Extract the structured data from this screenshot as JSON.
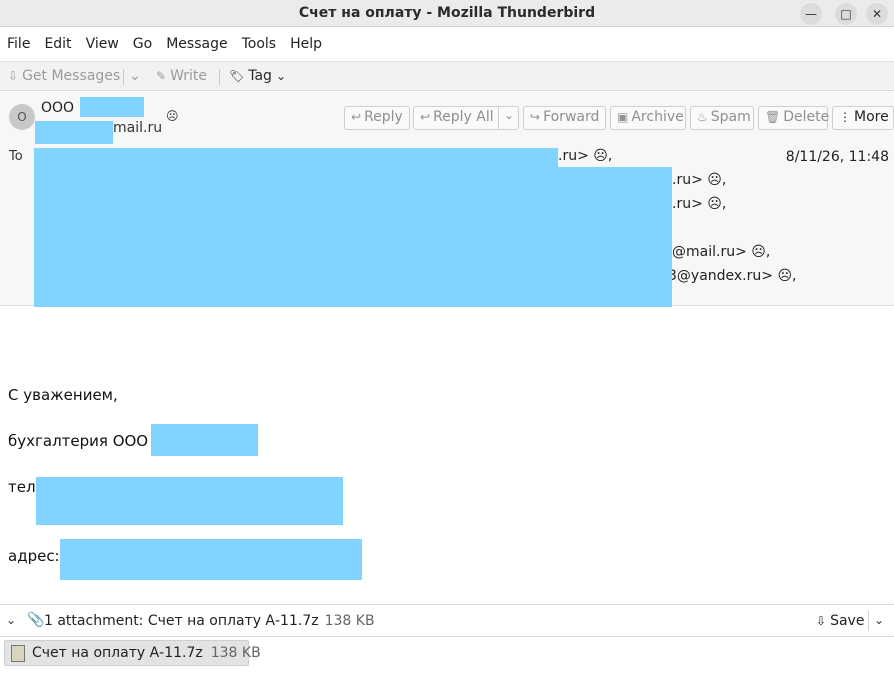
{
  "window": {
    "title": "Счет на оплату - Mozilla Thunderbird",
    "minimize_glyph": "—",
    "maximize_glyph": "□",
    "close_glyph": "✕"
  },
  "menu": [
    "File",
    "Edit",
    "View",
    "Go",
    "Message",
    "Tools",
    "Help"
  ],
  "toolbar": {
    "get_messages": "Get Messages",
    "write": "Write",
    "tag": "Tag"
  },
  "header": {
    "avatar_initial": "O",
    "from_name": "ООО",
    "from_email_suffix": "mail.ru",
    "buttons": {
      "reply": "Reply",
      "reply_all": "Reply All",
      "forward": "Forward",
      "archive": "Archive",
      "spam": "Spam",
      "delete": "Delete",
      "more": "More"
    },
    "to_label": "To",
    "date": "8/11/26, 11:48",
    "recipients_visible": [
      ".ru> ☹,",
      ".ru> ☹,",
      ".ru> ☹,",
      "@mail.ru> ☹,",
      "3@yandex.ru> ☹,"
    ]
  },
  "body": {
    "regards": "С уважением,",
    "company": "бухгалтерия ООО",
    "phone_label": "тел.",
    "address_label": "адрес:"
  },
  "attachments": {
    "summary": "1 attachment: Счет на оплату А-11.7z",
    "summary_size": "138 KB",
    "save_label": "Save",
    "items": [
      {
        "name": "Счет на оплату А-11.7z",
        "size": "138 KB"
      }
    ]
  },
  "colors": {
    "redaction": "#80d4ff"
  }
}
